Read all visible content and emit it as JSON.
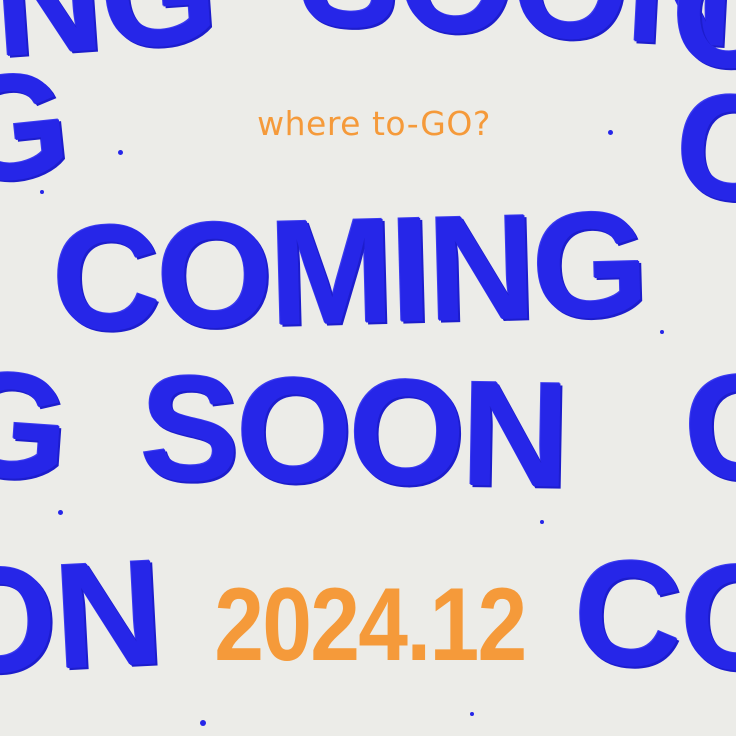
{
  "poster": {
    "tagline": "where to-GO?",
    "headline_line1": "COMING",
    "headline_line2": "SOON",
    "date": "2024.12",
    "colors": {
      "background": "#ecece8",
      "headline": "#2626e8",
      "accent": "#f59a3a"
    }
  }
}
